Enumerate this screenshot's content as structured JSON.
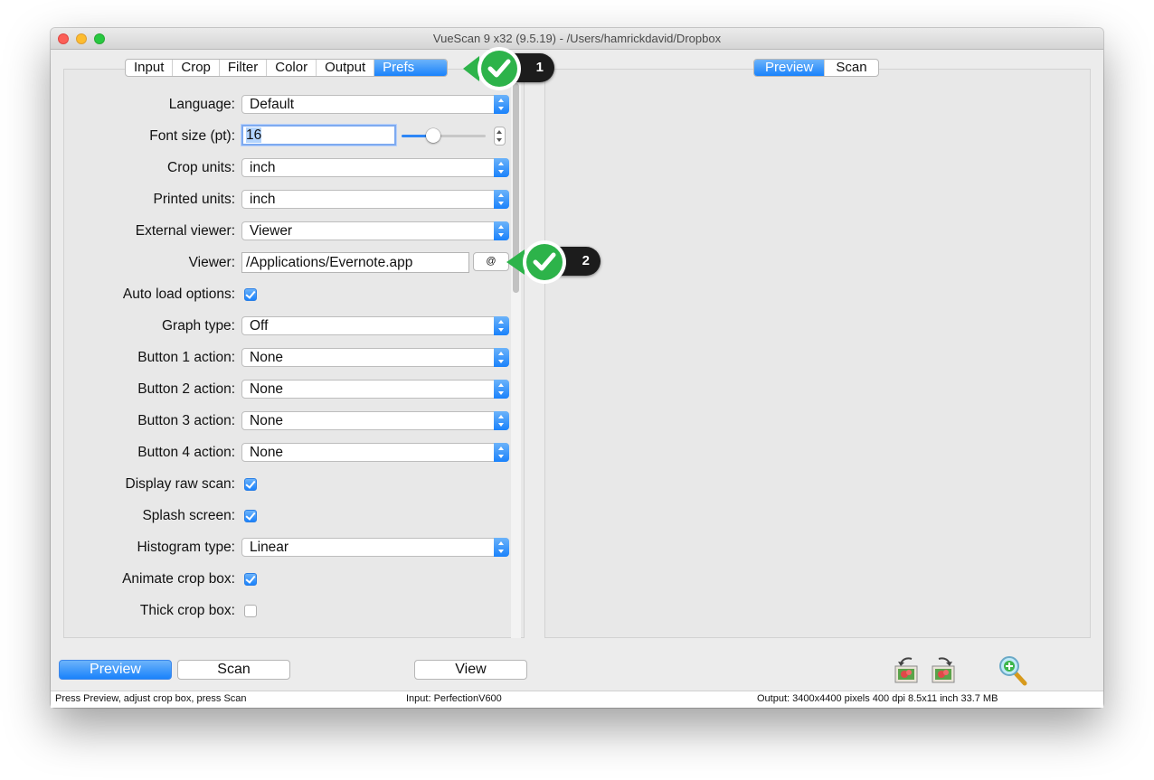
{
  "window": {
    "title": "VueScan 9 x32 (9.5.19) - /Users/hamrickdavid/Dropbox"
  },
  "tabs_left": [
    {
      "label": "Input",
      "active": false
    },
    {
      "label": "Crop",
      "active": false
    },
    {
      "label": "Filter",
      "active": false
    },
    {
      "label": "Color",
      "active": false
    },
    {
      "label": "Output",
      "active": false
    },
    {
      "label": "Prefs",
      "active": true
    }
  ],
  "tabs_right": [
    {
      "label": "Preview",
      "active": true
    },
    {
      "label": "Scan",
      "active": false
    }
  ],
  "prefs": {
    "language": {
      "label": "Language:",
      "value": "Default"
    },
    "font_size": {
      "label": "Font size (pt):",
      "value": "16",
      "slider_fraction": 0.38
    },
    "crop_units": {
      "label": "Crop units:",
      "value": "inch"
    },
    "printed_units": {
      "label": "Printed units:",
      "value": "inch"
    },
    "external_viewer": {
      "label": "External viewer:",
      "value": "Viewer"
    },
    "viewer": {
      "label": "Viewer:",
      "value": "/Applications/Evernote.app",
      "browse_label": "@"
    },
    "auto_load": {
      "label": "Auto load options:",
      "checked": true
    },
    "graph_type": {
      "label": "Graph type:",
      "value": "Off"
    },
    "button1": {
      "label": "Button 1 action:",
      "value": "None"
    },
    "button2": {
      "label": "Button 2 action:",
      "value": "None"
    },
    "button3": {
      "label": "Button 3 action:",
      "value": "None"
    },
    "button4": {
      "label": "Button 4 action:",
      "value": "None"
    },
    "display_raw": {
      "label": "Display raw scan:",
      "checked": true
    },
    "splash": {
      "label": "Splash screen:",
      "checked": true
    },
    "histogram": {
      "label": "Histogram type:",
      "value": "Linear"
    },
    "animate_crop": {
      "label": "Animate crop box:",
      "checked": true
    },
    "thick_crop": {
      "label": "Thick crop box:",
      "checked": false
    }
  },
  "bottom": {
    "preview": "Preview",
    "scan": "Scan",
    "view": "View"
  },
  "status": {
    "left": "Press Preview, adjust crop box, press Scan",
    "middle": "Input: PerfectionV600",
    "right": "Output: 3400x4400 pixels 400 dpi 8.5x11 inch 33.7 MB"
  },
  "callouts": [
    {
      "number": "1"
    },
    {
      "number": "2"
    }
  ],
  "colors": {
    "accent": "#1a82fb",
    "badge_green": "#2db34a"
  }
}
